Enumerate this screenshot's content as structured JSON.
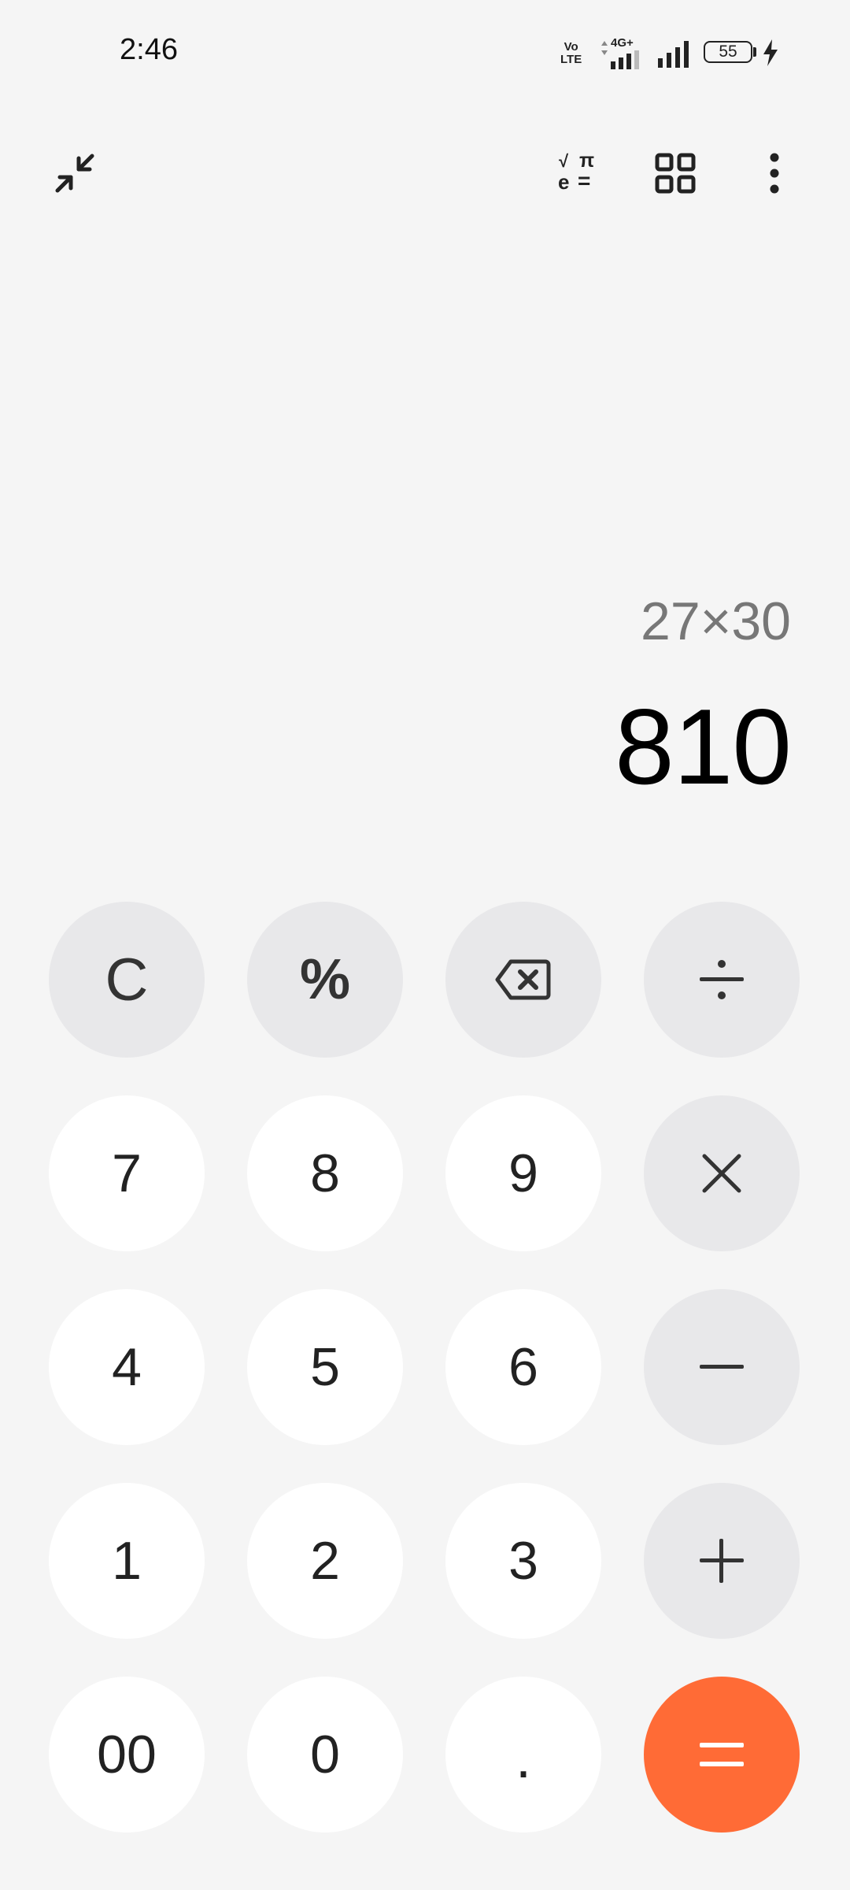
{
  "status_bar": {
    "time": "2:46",
    "volte_label_line1": "Vo",
    "volte_label_line2": "LTE",
    "network_type": "4G+",
    "battery_level": "55",
    "charging": true
  },
  "toolbar": {
    "collapse_icon": "collapse-arrows-icon",
    "scientific_icon": "scientific-functions-icon",
    "scientific_symbols": {
      "sqrt": "√",
      "pi": "π",
      "e": "e",
      "equals": "="
    },
    "converter_icon": "grid-icon",
    "menu_icon": "more-vert-icon"
  },
  "display": {
    "expression": "27×30",
    "result": "810"
  },
  "keypad": {
    "clear": "C",
    "percent": "%",
    "backspace_icon": "backspace-icon",
    "divide_icon": "divide-icon",
    "multiply_icon": "multiply-icon",
    "minus_icon": "minus-icon",
    "plus_icon": "plus-icon",
    "equals_icon": "equals-icon",
    "digits": {
      "d7": "7",
      "d8": "8",
      "d9": "9",
      "d4": "4",
      "d5": "5",
      "d6": "6",
      "d1": "1",
      "d2": "2",
      "d3": "3",
      "d00": "00",
      "d0": "0",
      "decimal": "."
    }
  },
  "colors": {
    "background": "#f5f5f5",
    "number_key": "#ffffff",
    "function_key": "#e8e8ea",
    "equals_key": "#ff6b36",
    "expression_text": "#777777",
    "result_text": "#000000"
  }
}
